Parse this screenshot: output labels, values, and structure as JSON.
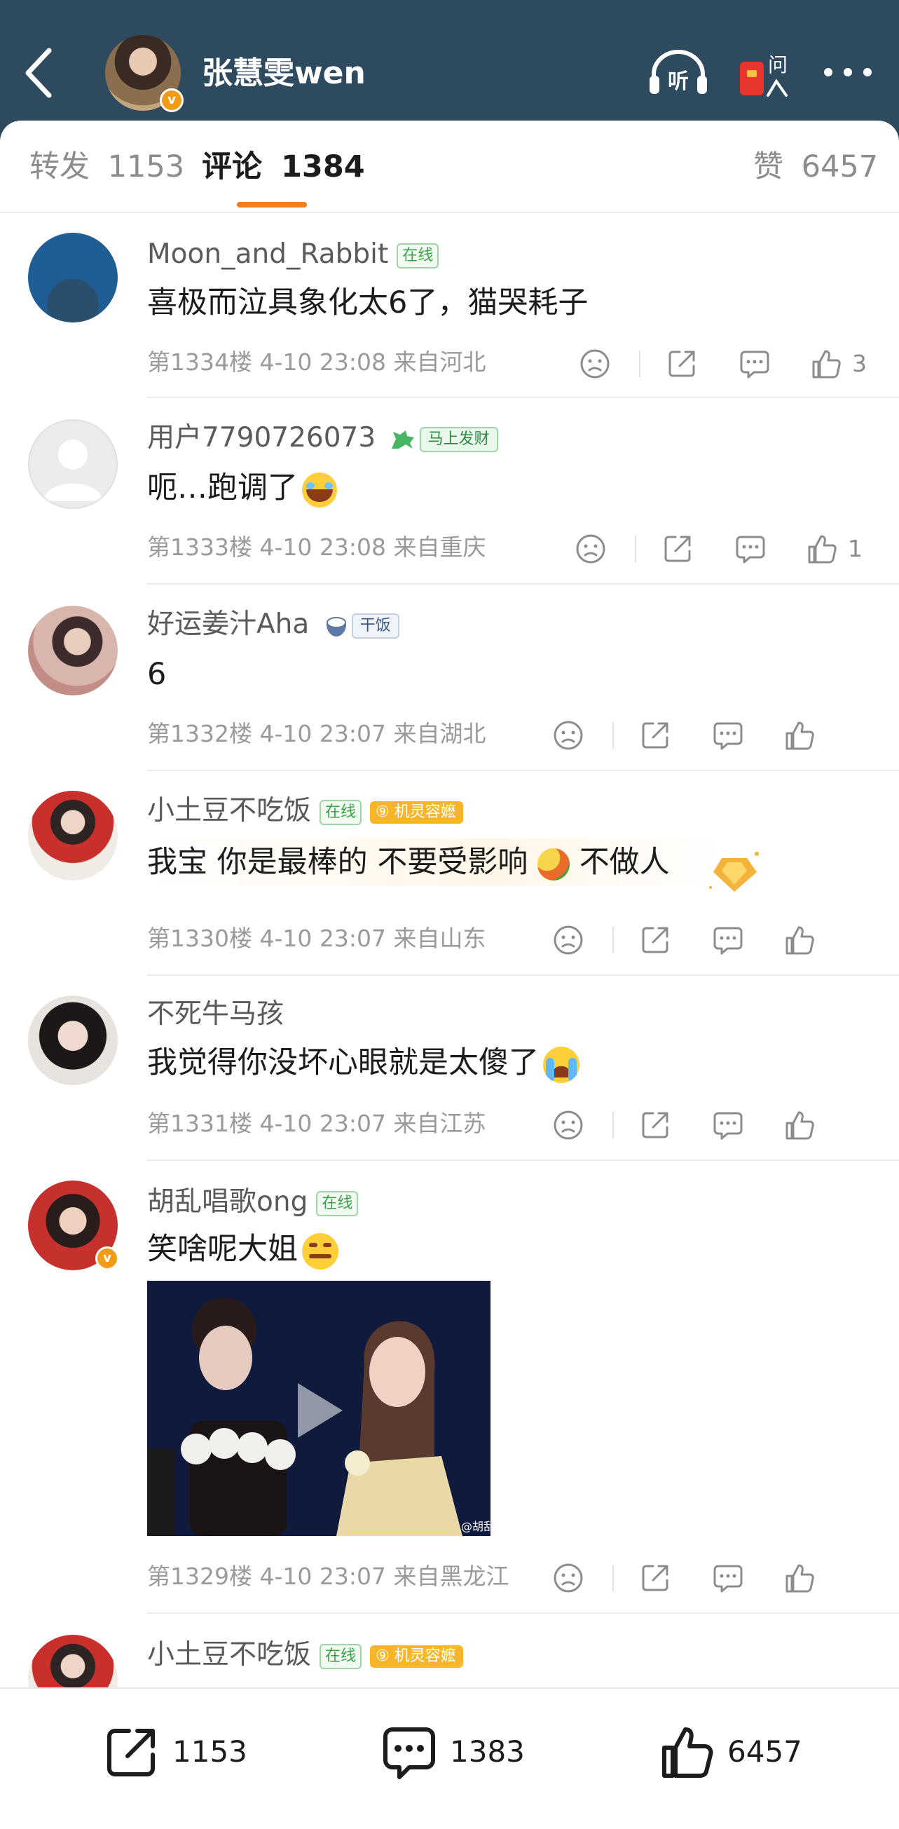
{
  "header": {
    "title": "张慧雯wen",
    "listen_label": "听",
    "ask_label": "问"
  },
  "tabs": {
    "repost": {
      "label": "转发",
      "count": "1153"
    },
    "comment": {
      "label": "评论",
      "count": "1384"
    },
    "like": {
      "label": "赞",
      "count": "6457"
    }
  },
  "comments": [
    {
      "user": "Moon_and_Rabbit",
      "badge": "在线",
      "text": "喜极而泣具象化太6了，猫哭耗子",
      "meta": "第1334楼 4-10 23:08 来自河北",
      "likes": "3"
    },
    {
      "user": "用户7790726073",
      "badge": "马上发财",
      "text": "呃…跑调了",
      "meta": "第1333楼 4-10 23:08 来自重庆",
      "likes": "1"
    },
    {
      "user": "好运姜汁Aha",
      "badge": "干饭",
      "text": "6",
      "meta": "第1332楼 4-10 23:07 来自湖北",
      "likes": ""
    },
    {
      "user": "小土豆不吃饭",
      "badge": "在线",
      "badge2": "机灵容嬷",
      "text_a": "我宝 你是最棒的 不要受影响",
      "text_b": "不做人",
      "meta": "第1330楼 4-10 23:07 来自山东",
      "likes": ""
    },
    {
      "user": "不死牛马孩",
      "text": "我觉得你没坏心眼就是太傻了",
      "meta": "第1331楼 4-10 23:07 来自江苏",
      "likes": ""
    },
    {
      "user": "胡乱唱歌ong",
      "badge": "在线",
      "text": "笑啥呢大姐",
      "watermark": "@胡乱",
      "meta": "第1329楼 4-10 23:07 来自黑龙江",
      "likes": ""
    },
    {
      "user": "小土豆不吃饭",
      "badge": "在线",
      "badge2": "机灵容嬷"
    }
  ],
  "bottom_bar": {
    "repost": "1153",
    "comment": "1383",
    "like": "6457"
  },
  "colors": {
    "header_bg": "#2e4a5f",
    "accent": "#f27d1d",
    "online_green": "#3da04b"
  }
}
